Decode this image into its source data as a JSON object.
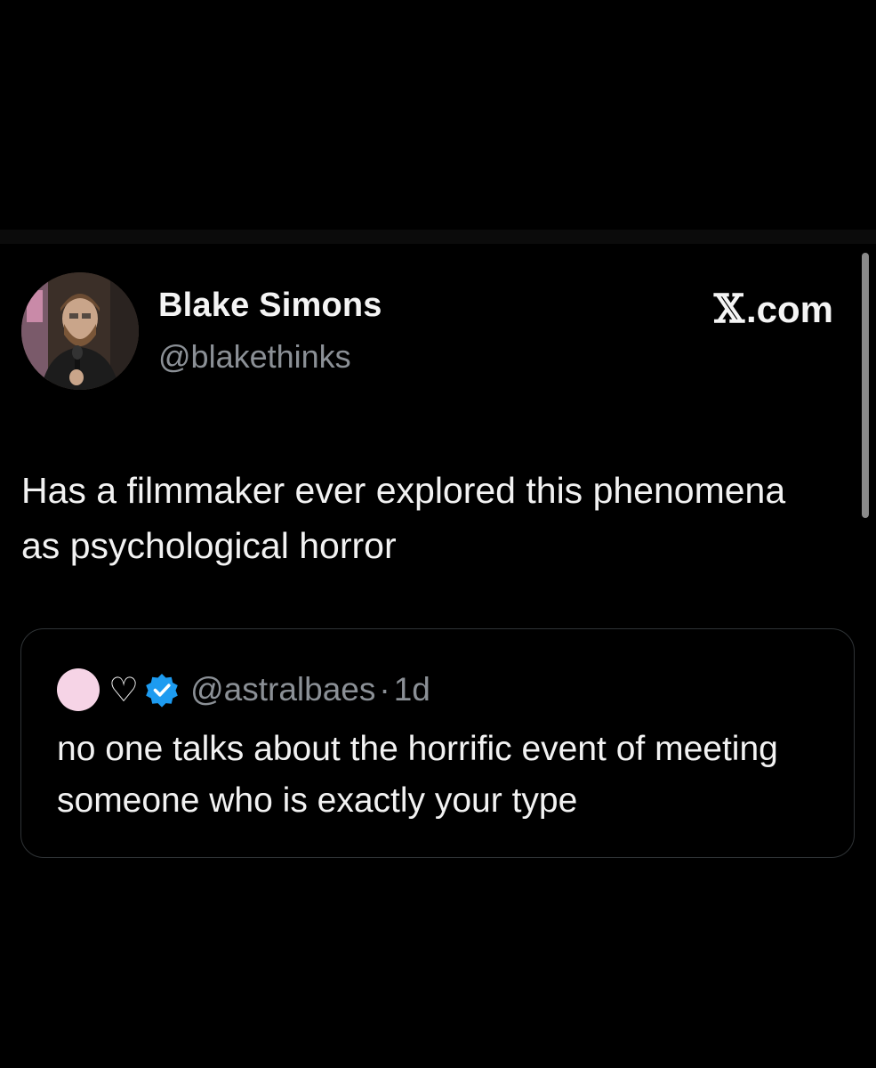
{
  "author": {
    "name": "Blake Simons",
    "handle": "@blakethinks"
  },
  "brand": {
    "x_glyph": "𝕏",
    "domain": ".com"
  },
  "tweet": {
    "text": "Has a filmmaker ever explored this phenomena as psychological horror"
  },
  "quoted": {
    "handle": "@astralbaes",
    "separator": "·",
    "time": "1d",
    "text": "no one talks about the horrific event of meeting someone who is exactly your type",
    "heart_glyph": "♡"
  },
  "colors": {
    "background": "#000000",
    "verified": "#1d9bf0",
    "pink_dot": "#f6d4e6",
    "secondary_text": "#8b9096"
  },
  "icons": {
    "avatar": "profile-photo",
    "verified": "verified-badge-icon",
    "heart": "heart-outline-icon",
    "dot": "pink-circle-emoji"
  }
}
